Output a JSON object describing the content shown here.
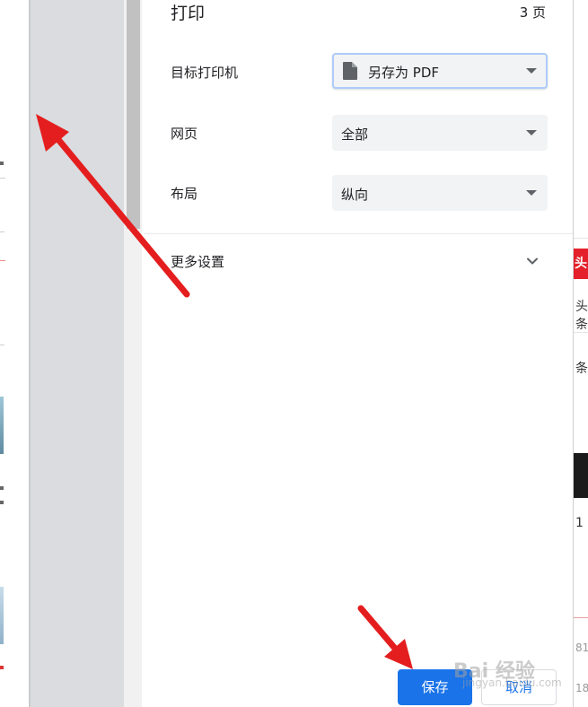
{
  "dialog": {
    "title": "打印",
    "page_count": "3 页",
    "rows": [
      {
        "label": "目标打印机",
        "value": "另存为 PDF"
      },
      {
        "label": "网页",
        "value": "全部"
      },
      {
        "label": "布局",
        "value": "纵向"
      }
    ],
    "more_settings": "更多设置",
    "buttons": {
      "save": "保存",
      "cancel": "取消"
    }
  },
  "background_page": {
    "right_fragments": [
      "头",
      "头条",
      "条",
      "1",
      "81",
      "18"
    ]
  },
  "watermark": {
    "logo": "Bai 经验",
    "sub": "jingyan.baidu.com"
  },
  "colors": {
    "accent": "#1a73e8",
    "annotation_arrow": "#e41e1e",
    "preview_background": "#dadce0",
    "select_background": "#f1f3f4"
  },
  "icons": {
    "destination": "pdf-document-icon",
    "dropdown": "caret-down-icon",
    "expand": "chevron-down-icon"
  }
}
